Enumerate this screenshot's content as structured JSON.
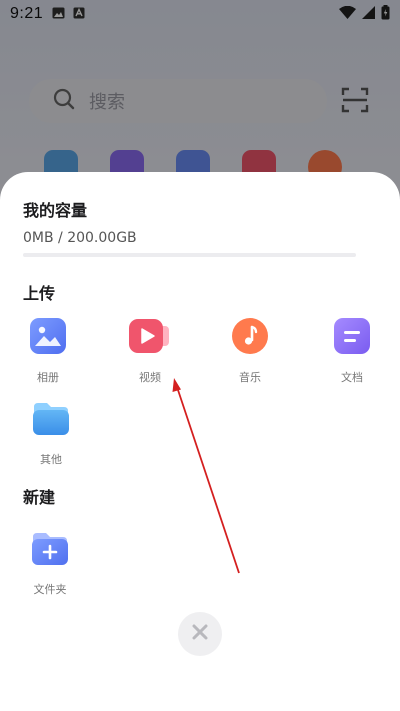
{
  "status_bar": {
    "time": "9:21"
  },
  "background": {
    "search_placeholder": "搜索"
  },
  "sheet": {
    "capacity": {
      "title": "我的容量",
      "usage": "0MB / 200.00GB",
      "used_fraction": 0
    },
    "upload": {
      "title": "上传",
      "items": [
        {
          "label": "相册",
          "icon": "album-icon"
        },
        {
          "label": "视频",
          "icon": "video-icon"
        },
        {
          "label": "音乐",
          "icon": "music-icon"
        },
        {
          "label": "文档",
          "icon": "document-icon"
        },
        {
          "label": "其他",
          "icon": "folder-icon"
        }
      ]
    },
    "create": {
      "title": "新建",
      "items": [
        {
          "label": "文件夹",
          "icon": "new-folder-icon"
        }
      ]
    }
  },
  "colors": {
    "accent": "#5b7cfa",
    "video": "#f0556c",
    "music": "#ff7a4d",
    "document": "#8b6cf2"
  }
}
